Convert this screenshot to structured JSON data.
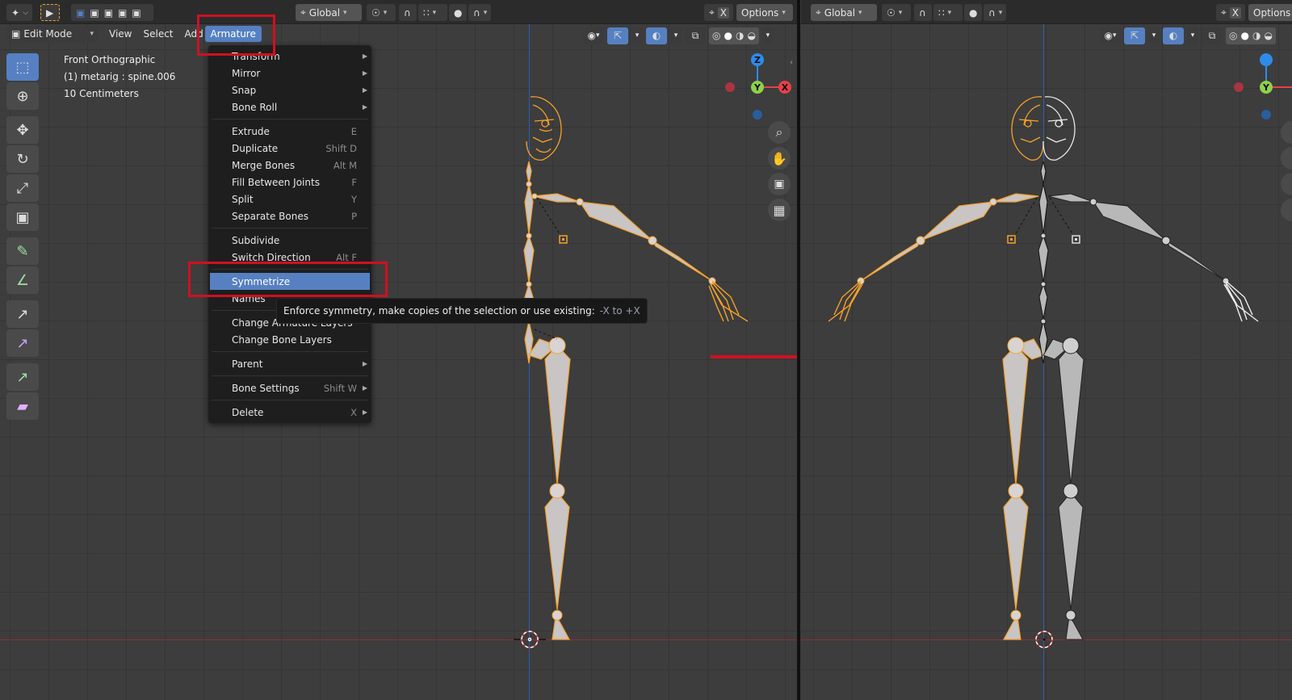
{
  "colors": {
    "accent": "#5680c2",
    "bone_select": "#f5a12a",
    "annotation_red": "#d01021",
    "axis_x": "#e8404a",
    "axis_y": "#8fd14b",
    "axis_z": "#2d8ceb"
  },
  "left_view": {
    "header": {
      "orientation": "Global",
      "options": "Options",
      "xray_label": "X"
    },
    "menubar": {
      "mode": "Edit Mode",
      "view": "View",
      "select": "Select",
      "add": "Add",
      "armature": "Armature"
    },
    "overlay_info": {
      "view_name": "Front Orthographic",
      "object": "(1) metarig : spine.006",
      "scale": "10 Centimeters"
    },
    "axis_labels": {
      "x": "X",
      "y": "Y",
      "z": "Z"
    },
    "armature_menu": {
      "groups": [
        [
          {
            "label": "Transform",
            "shortcut": "",
            "submenu": true
          },
          {
            "label": "Mirror",
            "shortcut": "",
            "submenu": true
          },
          {
            "label": "Snap",
            "shortcut": "",
            "submenu": true
          },
          {
            "label": "Bone Roll",
            "shortcut": "",
            "submenu": true
          }
        ],
        [
          {
            "label": "Extrude",
            "shortcut": "E",
            "submenu": false
          },
          {
            "label": "Duplicate",
            "shortcut": "Shift D",
            "submenu": false
          },
          {
            "label": "Merge Bones",
            "shortcut": "Alt M",
            "submenu": false
          },
          {
            "label": "Fill Between Joints",
            "shortcut": "F",
            "submenu": false
          },
          {
            "label": "Split",
            "shortcut": "Y",
            "submenu": false
          },
          {
            "label": "Separate Bones",
            "shortcut": "P",
            "submenu": false
          }
        ],
        [
          {
            "label": "Subdivide",
            "shortcut": "",
            "submenu": false
          },
          {
            "label": "Switch Direction",
            "shortcut": "Alt F",
            "submenu": false
          }
        ],
        [
          {
            "label": "Symmetrize",
            "shortcut": "",
            "submenu": false,
            "highlighted": true
          },
          {
            "label": "Names",
            "shortcut": "",
            "submenu": false
          }
        ],
        [
          {
            "label": "Change Armature Layers",
            "shortcut": "",
            "submenu": false
          },
          {
            "label": "Change Bone Layers",
            "shortcut": "",
            "submenu": false
          }
        ],
        [
          {
            "label": "Parent",
            "shortcut": "",
            "submenu": true
          }
        ],
        [
          {
            "label": "Bone Settings",
            "shortcut": "Shift W",
            "submenu": true
          }
        ],
        [
          {
            "label": "Delete",
            "shortcut": "X",
            "submenu": true
          }
        ]
      ]
    },
    "tooltip": {
      "text": "Enforce symmetry, make copies of the selection or use existing:",
      "hint": "-X to +X"
    }
  },
  "right_view": {
    "header": {
      "orientation": "Global",
      "options": "Options",
      "xray_label": "X"
    },
    "axis_labels": {
      "y": "Y"
    }
  }
}
